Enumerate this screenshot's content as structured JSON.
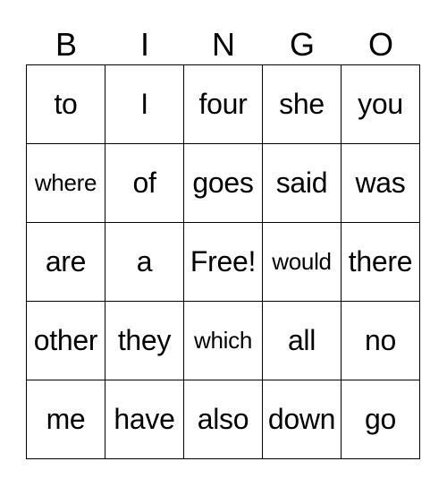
{
  "header": [
    "B",
    "I",
    "N",
    "G",
    "O"
  ],
  "rows": [
    [
      "to",
      "I",
      "four",
      "she",
      "you"
    ],
    [
      "where",
      "of",
      "goes",
      "said",
      "was"
    ],
    [
      "are",
      "a",
      "Free!",
      "would",
      "there"
    ],
    [
      "other",
      "they",
      "which",
      "all",
      "no"
    ],
    [
      "me",
      "have",
      "also",
      "down",
      "go"
    ]
  ]
}
